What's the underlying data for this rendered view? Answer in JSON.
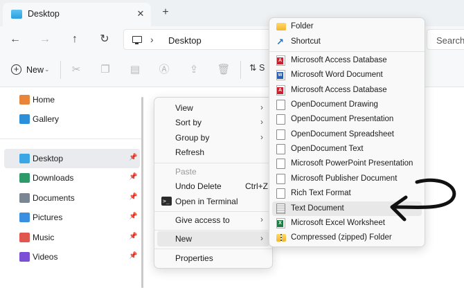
{
  "window": {
    "tab_title": "Desktop",
    "tab_close": "✕",
    "new_tab": "+"
  },
  "nav": {
    "back": "←",
    "forward": "→",
    "up": "↑",
    "refresh": "↻",
    "breadcrumb_separator": "›",
    "breadcrumb_location": "Desktop",
    "search_placeholder": "Search"
  },
  "toolbar": {
    "new_label": "New",
    "new_chevron": "⌄",
    "sort_label": "S",
    "sort_icon": "⇅"
  },
  "sidebar": {
    "pin_icon": "📌",
    "items": [
      {
        "label": "Home",
        "icon": "home-icon",
        "color": "#e8853a"
      },
      {
        "label": "Gallery",
        "icon": "gallery-icon",
        "color": "#2b8fd9"
      },
      {
        "label": "Desktop",
        "icon": "desktop-icon",
        "color": "#3aa6e6",
        "selected": true
      },
      {
        "label": "Downloads",
        "icon": "downloads-icon",
        "color": "#2e9a6a"
      },
      {
        "label": "Documents",
        "icon": "documents-icon",
        "color": "#7a8793"
      },
      {
        "label": "Pictures",
        "icon": "pictures-icon",
        "color": "#3b8fe0"
      },
      {
        "label": "Music",
        "icon": "music-icon",
        "color": "#e0574f"
      },
      {
        "label": "Videos",
        "icon": "videos-icon",
        "color": "#7a4fd6"
      }
    ]
  },
  "context_menu": {
    "items": [
      {
        "label": "View",
        "submenu": true
      },
      {
        "label": "Sort by",
        "submenu": true
      },
      {
        "label": "Group by",
        "submenu": true
      },
      {
        "label": "Refresh"
      },
      {
        "label": "Paste",
        "disabled": true
      },
      {
        "label": "Undo Delete",
        "shortcut": "Ctrl+Z"
      },
      {
        "label": "Open in Terminal",
        "icon": "terminal-icon"
      },
      {
        "label": "Give access to",
        "submenu": true
      },
      {
        "label": "New",
        "submenu": true,
        "highlighted": true
      },
      {
        "label": "Properties"
      }
    ],
    "submenu_arrow": "›",
    "terminal_glyph": ">_"
  },
  "new_submenu": {
    "items": [
      {
        "label": "Folder",
        "icon": "folder-icon"
      },
      {
        "label": "Shortcut",
        "icon": "shortcut-icon"
      },
      {
        "label": "Microsoft Access Database",
        "icon": "access-icon"
      },
      {
        "label": "Microsoft Word Document",
        "icon": "word-icon"
      },
      {
        "label": "Microsoft Access Database",
        "icon": "access-icon"
      },
      {
        "label": "OpenDocument Drawing",
        "icon": "document-icon"
      },
      {
        "label": "OpenDocument Presentation",
        "icon": "document-icon"
      },
      {
        "label": "OpenDocument Spreadsheet",
        "icon": "document-icon"
      },
      {
        "label": "OpenDocument Text",
        "icon": "document-icon"
      },
      {
        "label": "Microsoft PowerPoint Presentation",
        "icon": "document-icon"
      },
      {
        "label": "Microsoft Publisher Document",
        "icon": "document-icon"
      },
      {
        "label": "Rich Text Format",
        "icon": "document-icon"
      },
      {
        "label": "Text Document",
        "icon": "text-document-icon",
        "highlighted": true
      },
      {
        "label": "Microsoft Excel Worksheet",
        "icon": "excel-icon"
      },
      {
        "label": "Compressed (zipped) Folder",
        "icon": "zip-folder-icon"
      }
    ],
    "shortcut_glyph": "↗"
  },
  "colors": {
    "accent": "#0067c0",
    "annotation_arrow": "#111111"
  }
}
